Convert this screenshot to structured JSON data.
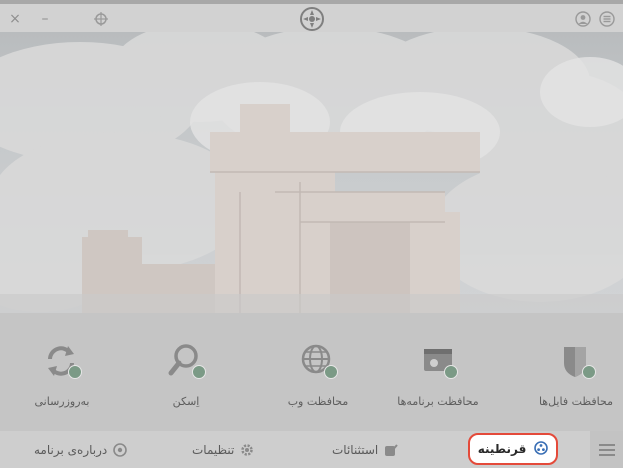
{
  "titlebar": {
    "close_glyph": "×",
    "minimize_glyph": "–",
    "icons": [
      "close-icon",
      "minimize-icon",
      "pin-icon",
      "app-logo-icon",
      "user-icon",
      "menu-icon"
    ]
  },
  "features": [
    {
      "label": "محافظت فایل‌ها",
      "icon": "shield-icon"
    },
    {
      "label": "محافظت برنامه‌ها",
      "icon": "app-protection-icon"
    },
    {
      "label": "محافظت وب",
      "icon": "globe-icon"
    },
    {
      "label": "اِسکن",
      "icon": "scan-icon"
    },
    {
      "label": "به‌روزرسانی",
      "icon": "update-icon"
    }
  ],
  "nav": {
    "quarantine": "قرنطینه",
    "exceptions": "استثنائات",
    "settings": "تنظیمات",
    "about": "درباره‌ی برنامه"
  },
  "colors": {
    "highlight_border": "#e44a3a",
    "check_badge": "#7b9a86",
    "icon_gray": "#8a8a8a"
  }
}
